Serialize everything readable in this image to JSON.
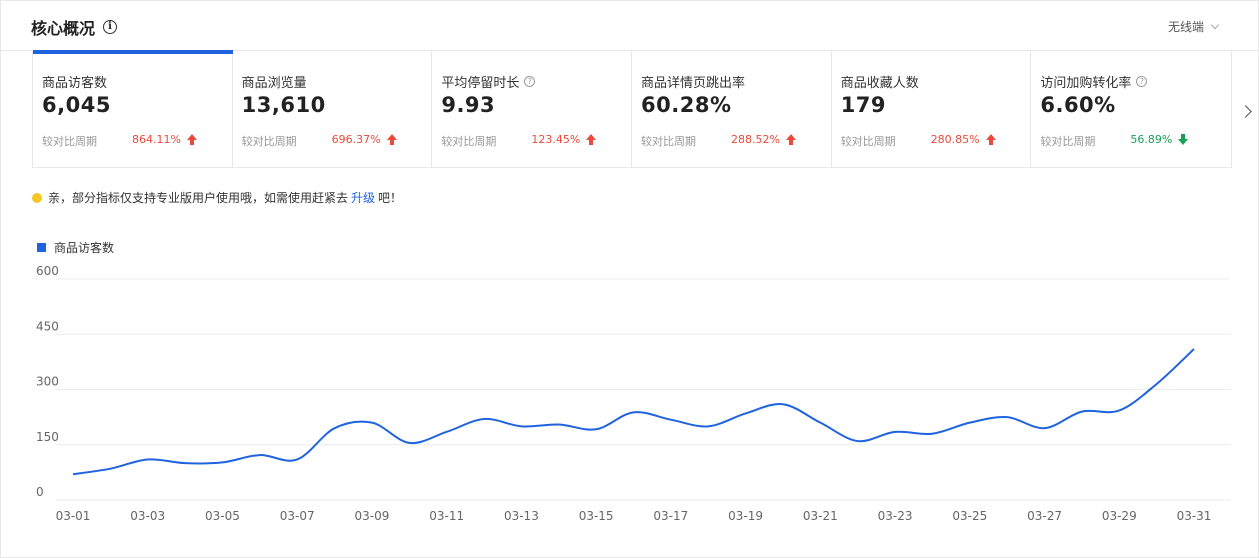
{
  "header": {
    "title": "核心概况",
    "info_icon": "info-icon",
    "device_select": "无线端"
  },
  "metrics": [
    {
      "label": "商品访客数",
      "value": "6,045",
      "compare_label": "较对比周期",
      "change": "864.11%",
      "direction": "up",
      "help": false,
      "active": true
    },
    {
      "label": "商品浏览量",
      "value": "13,610",
      "compare_label": "较对比周期",
      "change": "696.37%",
      "direction": "up",
      "help": false,
      "active": false
    },
    {
      "label": "平均停留时长",
      "value": "9.93",
      "compare_label": "较对比周期",
      "change": "123.45%",
      "direction": "up",
      "help": true,
      "active": false
    },
    {
      "label": "商品详情页跳出率",
      "value": "60.28%",
      "compare_label": "较对比周期",
      "change": "288.52%",
      "direction": "up",
      "help": false,
      "active": false
    },
    {
      "label": "商品收藏人数",
      "value": "179",
      "compare_label": "较对比周期",
      "change": "280.85%",
      "direction": "up",
      "help": false,
      "active": false
    },
    {
      "label": "访问加购转化率",
      "value": "6.60%",
      "compare_label": "较对比周期",
      "change": "56.89%",
      "direction": "down",
      "help": true,
      "active": false
    }
  ],
  "notice": {
    "prefix": "亲，部分指标仅支持专业版用户使用哦，如需使用赶紧去",
    "link": "升级",
    "suffix": "吧！"
  },
  "colors": {
    "accent": "#1f63e0",
    "up": "#e84a3b",
    "down": "#18a058"
  },
  "chart_data": {
    "type": "line",
    "legend": "商品访客数",
    "x": [
      "03-01",
      "03-02",
      "03-03",
      "03-04",
      "03-05",
      "03-06",
      "03-07",
      "03-08",
      "03-09",
      "03-10",
      "03-11",
      "03-12",
      "03-13",
      "03-14",
      "03-15",
      "03-16",
      "03-17",
      "03-18",
      "03-19",
      "03-20",
      "03-21",
      "03-22",
      "03-23",
      "03-24",
      "03-25",
      "03-26",
      "03-27",
      "03-28",
      "03-29",
      "03-30",
      "03-31"
    ],
    "x_tick_labels": [
      "03-01",
      "03-03",
      "03-05",
      "03-07",
      "03-09",
      "03-11",
      "03-13",
      "03-15",
      "03-17",
      "03-19",
      "03-21",
      "03-23",
      "03-25",
      "03-27",
      "03-29",
      "03-31"
    ],
    "series": [
      {
        "name": "商品访客数",
        "values": [
          70,
          85,
          110,
          100,
          102,
          122,
          110,
          195,
          210,
          155,
          185,
          220,
          200,
          205,
          192,
          238,
          218,
          200,
          235,
          260,
          210,
          160,
          185,
          180,
          210,
          225,
          195,
          240,
          243,
          315,
          410
        ]
      }
    ],
    "ylim": [
      0,
      600
    ],
    "yticks": [
      0,
      150,
      300,
      450,
      600
    ],
    "grid": true
  }
}
